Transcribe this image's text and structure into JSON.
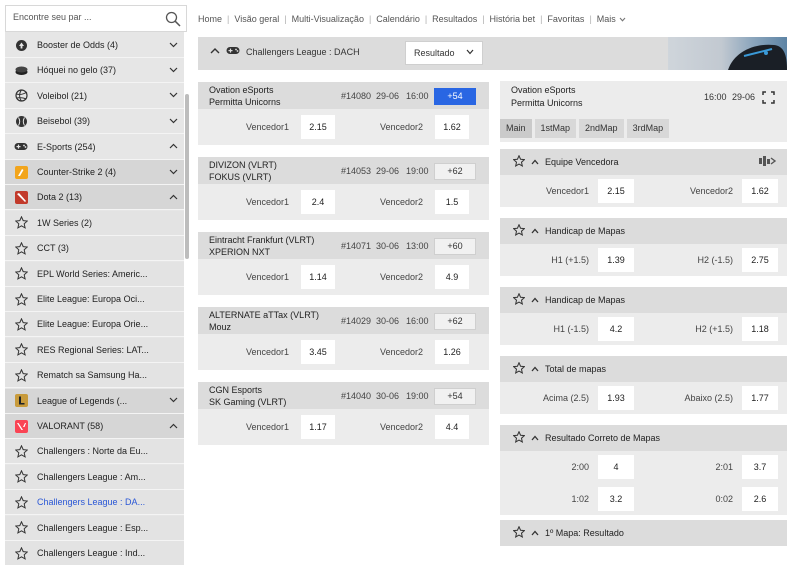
{
  "search": {
    "placeholder": "Encontre seu par ..."
  },
  "sidebar": {
    "items": [
      {
        "label": "Booster de Odds (4)",
        "icon": "booster-icon",
        "kind": "cat",
        "chev": "down"
      },
      {
        "label": "Hóquei no gelo (37)",
        "icon": "puck-icon",
        "kind": "cat",
        "chev": "down"
      },
      {
        "label": "Voleibol (21)",
        "icon": "volleyball-icon",
        "kind": "cat",
        "chev": "down"
      },
      {
        "label": "Beisebol (39)",
        "icon": "baseball-icon",
        "kind": "cat",
        "chev": "down"
      },
      {
        "label": "E-Sports (254)",
        "icon": "gamepad-icon",
        "kind": "cat",
        "chev": "up"
      },
      {
        "label": "Counter-Strike 2 (4)",
        "icon": "counter-strike-icon",
        "kind": "sub",
        "chev": "down"
      },
      {
        "label": "Dota 2 (13)",
        "icon": "dota-icon",
        "kind": "sub",
        "chev": "up"
      },
      {
        "label": "1W Series (2)",
        "icon": "star-icon",
        "kind": "league"
      },
      {
        "label": "CCT (3)",
        "icon": "star-icon",
        "kind": "league"
      },
      {
        "label": "EPL World Series: Americ...",
        "icon": "star-icon",
        "kind": "league"
      },
      {
        "label": "Elite League: Europa Oci...",
        "icon": "star-icon",
        "kind": "league"
      },
      {
        "label": "Elite League: Europa Orie...",
        "icon": "star-icon",
        "kind": "league"
      },
      {
        "label": "RES Regional Series: LAT...",
        "icon": "star-icon",
        "kind": "league"
      },
      {
        "label": "Rematch sa Samsung Ha...",
        "icon": "star-icon",
        "kind": "league"
      },
      {
        "label": "League of Legends (...",
        "icon": "lol-icon",
        "kind": "sub",
        "chev": "down"
      },
      {
        "label": "VALORANT (58)",
        "icon": "valorant-icon",
        "kind": "sub",
        "chev": "up"
      },
      {
        "label": "Challengers : Norte da Eu...",
        "icon": "star-icon",
        "kind": "league"
      },
      {
        "label": "Challengers League : Am...",
        "icon": "star-icon",
        "kind": "league"
      },
      {
        "label": "Challengers League : DA...",
        "icon": "star-icon",
        "kind": "league",
        "active": true
      },
      {
        "label": "Challengers League : Esp...",
        "icon": "star-icon",
        "kind": "league"
      },
      {
        "label": "Challengers League : Ind...",
        "icon": "star-icon",
        "kind": "league"
      }
    ]
  },
  "nav": {
    "links": [
      "Home",
      "Visão geral",
      "Multi-Visualização",
      "Calendário",
      "Resultados",
      "História bet",
      "Favoritas",
      "Mais"
    ]
  },
  "header": {
    "league": "Challengers League : DACH",
    "market_select": "Resultado"
  },
  "matches": [
    {
      "team1": "Ovation eSports",
      "team2": "Permitta Unicorns",
      "id": "#14080",
      "date": "29-06",
      "time": "16:00",
      "more": "+54",
      "selected": true,
      "label1": "Vencedor1",
      "odd1": "2.15",
      "label2": "Vencedor2",
      "odd2": "1.62"
    },
    {
      "team1": "DIVIZON (VLRT)",
      "team2": "FOKUS (VLRT)",
      "id": "#14053",
      "date": "29-06",
      "time": "19:00",
      "more": "+62",
      "label1": "Vencedor1",
      "odd1": "2.4",
      "label2": "Vencedor2",
      "odd2": "1.5"
    },
    {
      "team1": "Eintracht Frankfurt (VLRT)",
      "team2": "XPERION NXT",
      "id": "#14071",
      "date": "30-06",
      "time": "13:00",
      "more": "+60",
      "label1": "Vencedor1",
      "odd1": "1.14",
      "label2": "Vencedor2",
      "odd2": "4.9"
    },
    {
      "team1": "ALTERNATE aTTax (VLRT)",
      "team2": "Mouz",
      "id": "#14029",
      "date": "30-06",
      "time": "16:00",
      "more": "+62",
      "label1": "Vencedor1",
      "odd1": "3.45",
      "label2": "Vencedor2",
      "odd2": "1.26"
    },
    {
      "team1": "CGN Esports",
      "team2": "SK Gaming (VLRT)",
      "id": "#14040",
      "date": "30-06",
      "time": "19:00",
      "more": "+54",
      "label1": "Vencedor1",
      "odd1": "1.17",
      "label2": "Vencedor2",
      "odd2": "4.4"
    }
  ],
  "event": {
    "team1": "Ovation eSports",
    "team2": "Permitta Unicorns",
    "time": "16:00",
    "date": "29-06",
    "tabs": [
      "Main",
      "1stMap",
      "2ndMap",
      "3rdMap"
    ],
    "markets": [
      {
        "title": "Equipe Vencedora",
        "rows": [
          [
            {
              "label": "Vencedor1",
              "odd": "2.15"
            },
            {
              "label": "Vencedor2",
              "odd": "1.62"
            }
          ]
        ]
      },
      {
        "title": "Handicap de Mapas",
        "rows": [
          [
            {
              "label": "H1 (+1.5)",
              "odd": "1.39"
            },
            {
              "label": "H2 (-1.5)",
              "odd": "2.75"
            }
          ]
        ]
      },
      {
        "title": "Handicap de Mapas",
        "rows": [
          [
            {
              "label": "H1 (-1.5)",
              "odd": "4.2"
            },
            {
              "label": "H2 (+1.5)",
              "odd": "1.18"
            }
          ]
        ]
      },
      {
        "title": "Total de mapas",
        "rows": [
          [
            {
              "label": "Acima (2.5)",
              "odd": "1.93"
            },
            {
              "label": "Abaixo (2.5)",
              "odd": "1.77"
            }
          ]
        ]
      },
      {
        "title": "Resultado Correto de Mapas",
        "rows": [
          [
            {
              "label": "2:00",
              "odd": "4"
            },
            {
              "label": "2:01",
              "odd": "3.7"
            }
          ],
          [
            {
              "label": "1:02",
              "odd": "3.2"
            },
            {
              "label": "0:02",
              "odd": "2.6"
            }
          ]
        ]
      },
      {
        "title": "1º Mapa: Resultado",
        "rows": []
      }
    ]
  },
  "colors": {
    "accent": "#2966e3",
    "active_link": "#2a57d6",
    "panel": "#dcdcdc"
  }
}
